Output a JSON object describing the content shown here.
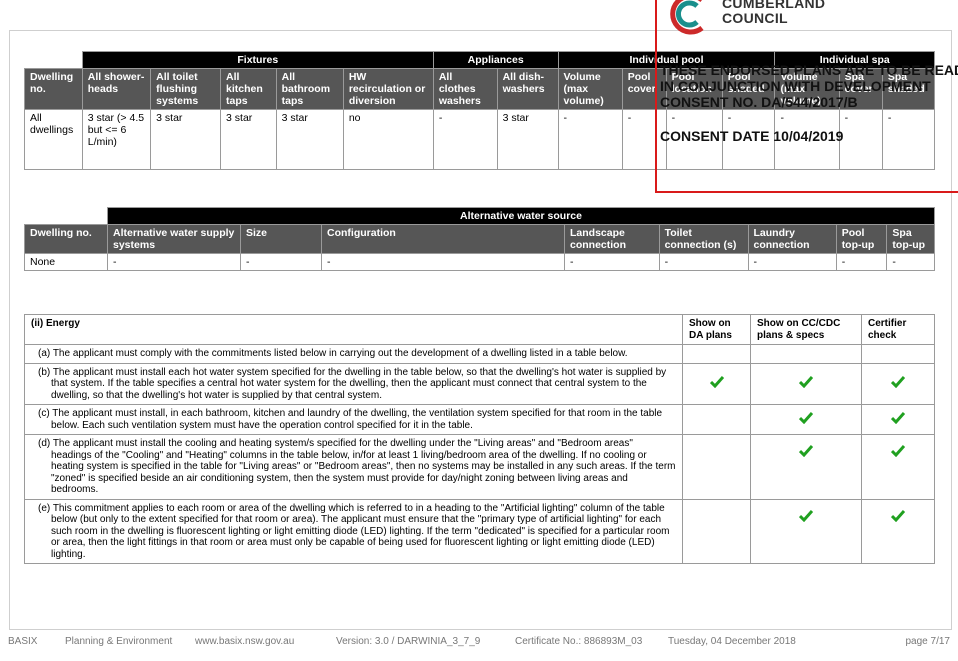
{
  "logo": {
    "line1": "CUMBERLAND",
    "line2": "COUNCIL"
  },
  "stamp": {
    "line1": "THESE ENDORSED PLANS ARE TO BE READ",
    "line2": "IN CONJUNCTION WITH DEVELOPMENT",
    "line3": "CONSENT NO. DA/544/2017/B",
    "line4": "CONSENT DATE 10/04/2019"
  },
  "fixtures_table": {
    "groups": [
      "Fixtures",
      "Appliances",
      "Individual pool",
      "Individual spa"
    ],
    "headers": [
      "Dwelling no.",
      "All shower-heads",
      "All toilet flushing systems",
      "All kitchen taps",
      "All bathroom taps",
      "HW recirculation or diversion",
      "All clothes washers",
      "All dish-washers",
      "Volume (max volume)",
      "Pool cover",
      "Pool location",
      "Pool shaded",
      "Volume (max volume)",
      "Spa cover",
      "Spa shaded"
    ],
    "row": [
      "All dwellings",
      "3 star (> 4.5 but <= 6 L/min)",
      "3 star",
      "3 star",
      "3 star",
      "no",
      "-",
      "3 star",
      "-",
      "-",
      "-",
      "-",
      "-",
      "-",
      "-"
    ]
  },
  "water_table": {
    "title": "Alternative water source",
    "headers": [
      "Dwelling no.",
      "Alternative water supply systems",
      "Size",
      "Configuration",
      "Landscape connection",
      "Toilet connection (s)",
      "Laundry connection",
      "Pool top-up",
      "Spa top-up"
    ],
    "row": [
      "None",
      "-",
      "-",
      "-",
      "-",
      "-",
      "-",
      "-",
      "-"
    ]
  },
  "energy_table": {
    "title": "(ii) Energy",
    "col1": "Show on DA plans",
    "col2": "Show on CC/CDC plans & specs",
    "col3": "Certifier check",
    "items": [
      {
        "text": "(a) The applicant must comply with the commitments listed below in carrying out the development of a dwelling listed in a table below.",
        "checks": [
          false,
          false,
          false
        ]
      },
      {
        "text": "(b) The applicant must install each hot water system specified for the dwelling in the table below, so that the dwelling's hot water is supplied by that system. If the table specifies a central hot water system for the dwelling, then the applicant must connect that central system to the dwelling, so that the dwelling's hot water is supplied by that central system.",
        "checks": [
          true,
          true,
          true
        ]
      },
      {
        "text": "(c) The applicant must install, in each bathroom, kitchen and laundry of the dwelling, the ventilation system specified for that room in the table below. Each such ventilation system must have the operation control specified for it in the table.",
        "checks": [
          false,
          true,
          true
        ]
      },
      {
        "text": "(d) The applicant must install the cooling and heating system/s specified for the dwelling under the \"Living areas\" and \"Bedroom areas\" headings of the \"Cooling\" and \"Heating\" columns in the table below, in/for at least 1 living/bedroom area of the dwelling. If no cooling or heating system is specified in the table for \"Living areas\" or \"Bedroom areas\", then no systems may be installed in any such areas. If the term \"zoned\" is specified beside an air conditioning system, then the system must provide for day/night zoning between living areas and bedrooms.",
        "checks": [
          false,
          true,
          true
        ]
      },
      {
        "text": "(e) This commitment applies to each room or area of the dwelling which is referred to in a heading to the \"Artificial lighting\" column of the table below (but only to the extent specified for that room or area). The applicant must ensure that the \"primary type of artificial lighting\" for each such room in the dwelling is fluorescent lighting or light emitting diode (LED) lighting. If the term \"dedicated\" is specified for a particular room or area, then the light fittings in that room or area must only be capable of being used for fluorescent lighting or light emitting diode (LED) lighting.",
        "checks": [
          false,
          true,
          true
        ]
      }
    ]
  },
  "footer": {
    "basix": "BASIX",
    "dept": "Planning & Environment",
    "url": "www.basix.nsw.gov.au",
    "version": "Version: 3.0 / DARWINIA_3_7_9",
    "cert": "Certificate No.: 886893M_03",
    "date": "Tuesday, 04 December 2018",
    "page": "page 7/17"
  },
  "colors": {
    "check": "#20a020",
    "stamp_border": "#d91a1a",
    "header_dark": "#000000",
    "header_grey": "#565656"
  }
}
